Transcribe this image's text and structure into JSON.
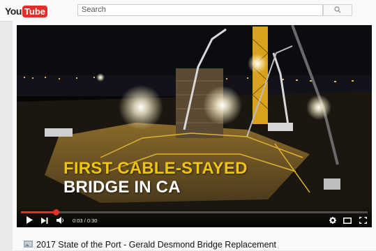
{
  "header": {
    "logo_you": "You",
    "logo_tube": "Tube",
    "search_placeholder": "Search",
    "search_icon": "magnifier-icon"
  },
  "video": {
    "caption_line1": "FIRST CABLE-STAYED",
    "caption_line2": "BRIDGE IN CA",
    "time_display": "0:03 / 0:30",
    "progress_fraction": 0.1,
    "title": "2017 State of the Port - Gerald Desmond Bridge Replacement"
  },
  "controls": {
    "icons": [
      "play-icon",
      "next-icon",
      "volume-icon",
      "settings-icon",
      "theater-mode-icon",
      "fullscreen-icon"
    ]
  },
  "colors": {
    "brand_red": "#e52d27",
    "caption_yellow": "#f1c40f",
    "caption_white": "#ffffff"
  }
}
